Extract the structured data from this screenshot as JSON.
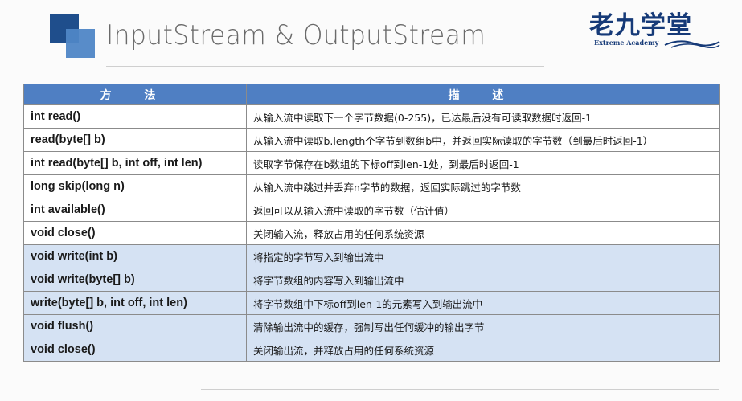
{
  "header": {
    "title": "InputStream & OutputStream",
    "brand_name": "老九学堂",
    "brand_sub": "Extreme Academy"
  },
  "colors": {
    "header_bg": "#4f7fc3",
    "output_row_bg": "#d5e2f3",
    "brand": "#163a78"
  },
  "table": {
    "col_method": "方 法",
    "col_desc": "描 述",
    "rows": [
      {
        "group": "input",
        "method": "int read()",
        "desc": "从输入流中读取下一个字节数据(0-255)，已达最后没有可读取数据时返回-1"
      },
      {
        "group": "input",
        "method": "read(byte[] b)",
        "desc": "从输入流中读取b.length个字节到数组b中，并返回实际读取的字节数（到最后时返回-1）"
      },
      {
        "group": "input",
        "method": "int read(byte[] b, int off, int len)",
        "desc": "读取字节保存在b数组的下标off到len-1处，到最后时返回-1"
      },
      {
        "group": "input",
        "method": "long skip(long n)",
        "desc": "从输入流中跳过并丢弃n字节的数据，返回实际跳过的字节数"
      },
      {
        "group": "input",
        "method": "int available()",
        "desc": "返回可以从输入流中读取的字节数（估计值）"
      },
      {
        "group": "input",
        "method": "void close()",
        "desc": "关闭输入流，释放占用的任何系统资源"
      },
      {
        "group": "output",
        "method": "void write(int b)",
        "desc": "将指定的字节写入到输出流中"
      },
      {
        "group": "output",
        "method": "void write(byte[] b)",
        "desc": "将字节数组的内容写入到输出流中"
      },
      {
        "group": "output",
        "method": "write(byte[] b, int off, int len)",
        "desc": "将字节数组中下标off到len-1的元素写入到输出流中"
      },
      {
        "group": "output",
        "method": "void flush()",
        "desc": "清除输出流中的缓存，强制写出任何缓冲的输出字节"
      },
      {
        "group": "output",
        "method": "void close()",
        "desc": "关闭输出流，并释放占用的任何系统资源"
      }
    ]
  }
}
